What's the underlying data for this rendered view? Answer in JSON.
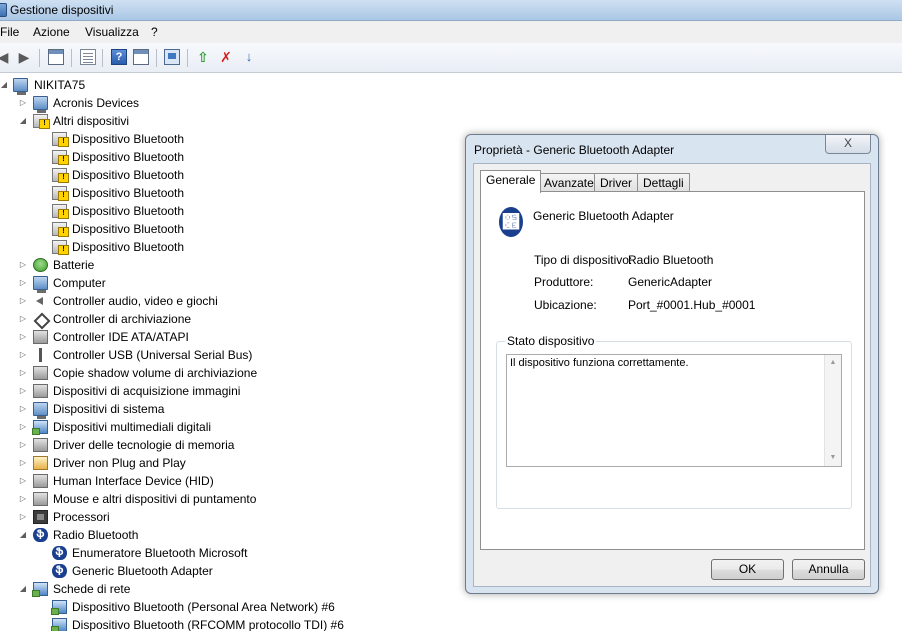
{
  "window": {
    "title": "Gestione dispositivi"
  },
  "menu": [
    "File",
    "Azione",
    "Visualizza",
    "?"
  ],
  "toolbar": {
    "icons": [
      "back-icon",
      "forward-icon",
      "view-icon",
      "properties-icon",
      "help-icon",
      "window-icon",
      "scan-icon",
      "update-driver-icon",
      "uninstall-icon",
      "disable-icon"
    ]
  },
  "tree": {
    "root": "NIKITA75",
    "items": [
      {
        "label": "Acronis Devices",
        "level": 1,
        "expander": "collapsed",
        "icon": "computer-icon"
      },
      {
        "label": "Altri dispositivi",
        "level": 1,
        "expander": "expanded",
        "icon": "warning-device-icon"
      },
      {
        "label": "Dispositivo Bluetooth",
        "level": 2,
        "expander": "none",
        "icon": "warning-device-icon"
      },
      {
        "label": "Dispositivo Bluetooth",
        "level": 2,
        "expander": "none",
        "icon": "warning-device-icon"
      },
      {
        "label": "Dispositivo Bluetooth",
        "level": 2,
        "expander": "none",
        "icon": "warning-device-icon"
      },
      {
        "label": "Dispositivo Bluetooth",
        "level": 2,
        "expander": "none",
        "icon": "warning-device-icon"
      },
      {
        "label": "Dispositivo Bluetooth",
        "level": 2,
        "expander": "none",
        "icon": "warning-device-icon"
      },
      {
        "label": "Dispositivo Bluetooth",
        "level": 2,
        "expander": "none",
        "icon": "warning-device-icon"
      },
      {
        "label": "Dispositivo Bluetooth",
        "level": 2,
        "expander": "none",
        "icon": "warning-device-icon"
      },
      {
        "label": "Batterie",
        "level": 1,
        "expander": "collapsed",
        "icon": "battery-icon"
      },
      {
        "label": "Computer",
        "level": 1,
        "expander": "collapsed",
        "icon": "computer-icon"
      },
      {
        "label": "Controller audio, video e giochi",
        "level": 1,
        "expander": "collapsed",
        "icon": "speaker-icon"
      },
      {
        "label": "Controller di archiviazione",
        "level": 1,
        "expander": "collapsed",
        "icon": "storage-controller-icon"
      },
      {
        "label": "Controller IDE ATA/ATAPI",
        "level": 1,
        "expander": "collapsed",
        "icon": "ide-controller-icon"
      },
      {
        "label": "Controller USB (Universal Serial Bus)",
        "level": 1,
        "expander": "collapsed",
        "icon": "usb-icon"
      },
      {
        "label": "Copie shadow volume di archiviazione",
        "level": 1,
        "expander": "collapsed",
        "icon": "disk-icon"
      },
      {
        "label": "Dispositivi di acquisizione immagini",
        "level": 1,
        "expander": "collapsed",
        "icon": "camera-icon"
      },
      {
        "label": "Dispositivi di sistema",
        "level": 1,
        "expander": "collapsed",
        "icon": "computer-icon"
      },
      {
        "label": "Dispositivi multimediali digitali",
        "level": 1,
        "expander": "collapsed",
        "icon": "media-device-icon"
      },
      {
        "label": "Driver delle tecnologie di memoria",
        "level": 1,
        "expander": "collapsed",
        "icon": "memory-icon"
      },
      {
        "label": "Driver non Plug and Play",
        "level": 1,
        "expander": "collapsed",
        "icon": "plug-icon"
      },
      {
        "label": "Human Interface Device (HID)",
        "level": 1,
        "expander": "collapsed",
        "icon": "hid-icon"
      },
      {
        "label": "Mouse e altri dispositivi di puntamento",
        "level": 1,
        "expander": "collapsed",
        "icon": "mouse-icon"
      },
      {
        "label": "Processori",
        "level": 1,
        "expander": "collapsed",
        "icon": "processor-icon"
      },
      {
        "label": "Radio Bluetooth",
        "level": 1,
        "expander": "expanded",
        "icon": "bluetooth-icon"
      },
      {
        "label": "Enumeratore Bluetooth Microsoft",
        "level": 2,
        "expander": "none",
        "icon": "bluetooth-icon"
      },
      {
        "label": "Generic Bluetooth Adapter",
        "level": 2,
        "expander": "none",
        "icon": "bluetooth-icon"
      },
      {
        "label": "Schede di rete",
        "level": 1,
        "expander": "expanded",
        "icon": "network-icon"
      },
      {
        "label": "Dispositivo Bluetooth (Personal Area Network) #6",
        "level": 2,
        "expander": "none",
        "icon": "network-icon"
      },
      {
        "label": "Dispositivo Bluetooth (RFCOMM protocollo TDI) #6",
        "level": 2,
        "expander": "none",
        "icon": "network-icon"
      }
    ]
  },
  "dialog": {
    "title": "Proprietà - Generic Bluetooth Adapter",
    "close": "X",
    "tabs": [
      "Generale",
      "Avanzate",
      "Driver",
      "Dettagli"
    ],
    "active_tab": "Generale",
    "device_name": "Generic Bluetooth Adapter",
    "properties": [
      {
        "label": "Tipo di dispositivo:",
        "value": "Radio Bluetooth"
      },
      {
        "label": "Produttore:",
        "value": "GenericAdapter"
      },
      {
        "label": "Ubicazione:",
        "value": "Port_#0001.Hub_#0001"
      }
    ],
    "status_group_label": "Stato dispositivo",
    "status_text": "Il dispositivo funziona correttamente.",
    "ok_label": "OK",
    "cancel_label": "Annulla"
  }
}
